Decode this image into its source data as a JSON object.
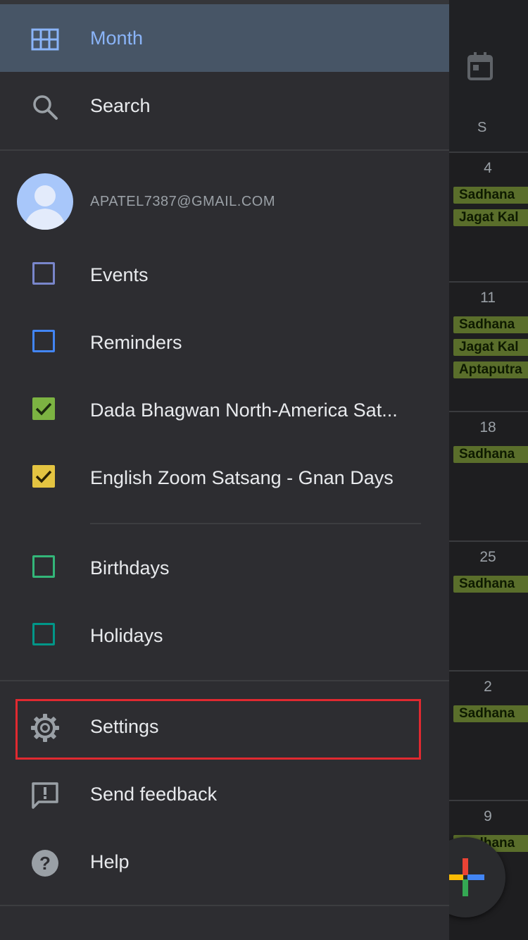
{
  "background_calendar": {
    "day_of_week": "S",
    "weeks": [
      {
        "date": "4",
        "events": [
          "Sadhana",
          "Jagat Kal"
        ]
      },
      {
        "date": "11",
        "events": [
          "Sadhana",
          "Jagat Kal",
          "Aptaputra"
        ]
      },
      {
        "date": "18",
        "events": [
          "Sadhana"
        ]
      },
      {
        "date": "25",
        "events": [
          "Sadhana"
        ]
      },
      {
        "date": "2",
        "events": [
          "Sadhana"
        ]
      },
      {
        "date": "9",
        "events": [
          "Sadhana"
        ]
      }
    ]
  },
  "drawer": {
    "views": [
      {
        "label": "Month",
        "icon": "grid-icon",
        "selected": true
      },
      {
        "label": "Search",
        "icon": "search-icon",
        "selected": false
      }
    ],
    "account": {
      "email": "APATEL7387@GMAIL.COM"
    },
    "calendars": [
      {
        "label": "Events",
        "checked": false,
        "color": "#7986cb"
      },
      {
        "label": "Reminders",
        "checked": false,
        "color": "#4285f4"
      },
      {
        "label": "Dada Bhagwan North-America Sat...",
        "checked": true,
        "color": "#7cb342"
      },
      {
        "label": "English Zoom Satsang - Gnan Days",
        "checked": true,
        "color": "#e4c441"
      }
    ],
    "other_calendars": [
      {
        "label": "Birthdays",
        "checked": false,
        "color": "#33b679"
      },
      {
        "label": "Holidays",
        "checked": false,
        "color": "#009688"
      }
    ],
    "footer": [
      {
        "label": "Settings",
        "icon": "gear-icon"
      },
      {
        "label": "Send feedback",
        "icon": "feedback-icon"
      },
      {
        "label": "Help",
        "icon": "help-icon"
      }
    ]
  },
  "colors": {
    "drawer_bg": "#2d2d31",
    "selected_bg": "#475566",
    "accent": "#8ab4f8",
    "event_chip": "#5a6e2b",
    "highlight": "#e02930"
  }
}
